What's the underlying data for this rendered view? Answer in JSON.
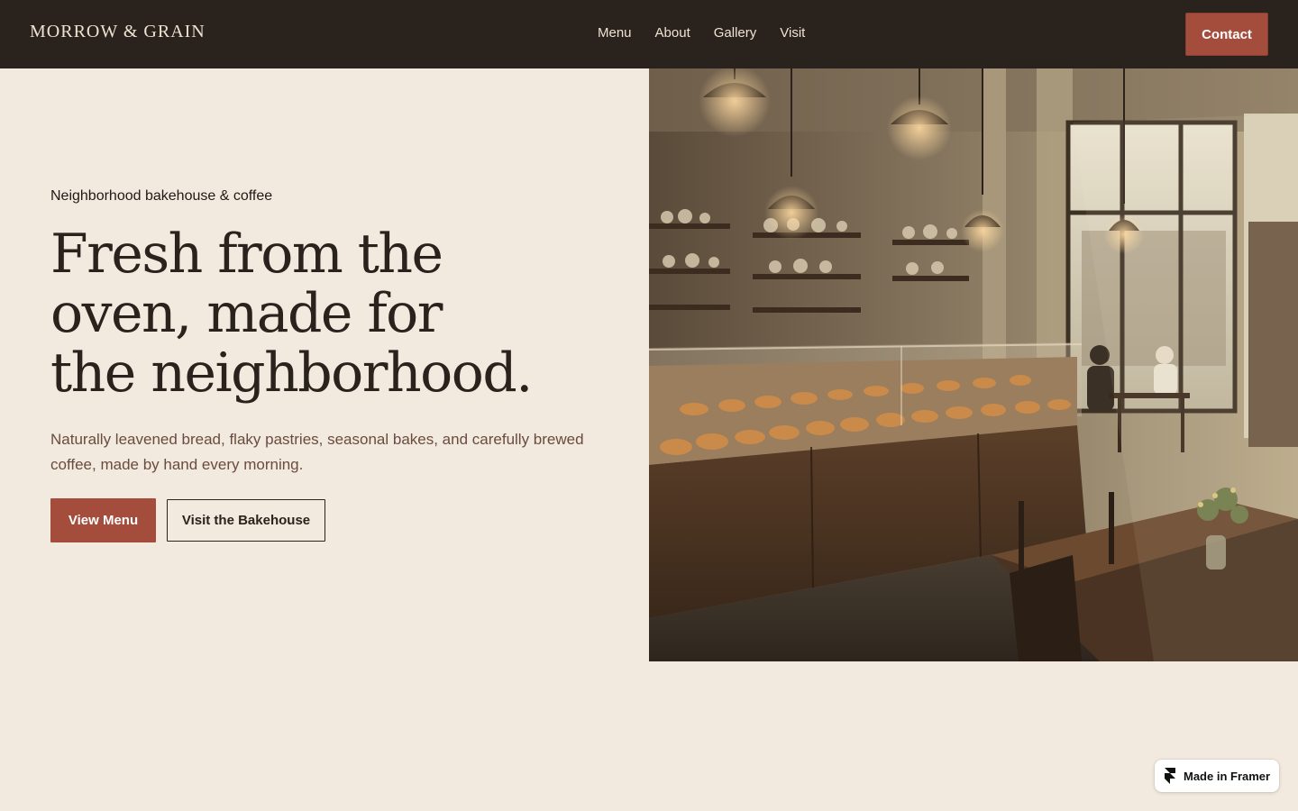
{
  "header": {
    "brand": "MORROW & GRAIN",
    "nav": [
      {
        "label": "Menu"
      },
      {
        "label": "About"
      },
      {
        "label": "Gallery"
      },
      {
        "label": "Visit"
      }
    ],
    "contact_label": "Contact"
  },
  "hero": {
    "eyebrow": "Neighborhood bakehouse & coffee",
    "headline_lines": [
      "Fresh from the",
      "oven, made for",
      "the neighborhood."
    ],
    "subcopy": "Naturally leavened bread, flaky pastries, seasonal bakes, and carefully brewed coffee, made by hand every morning.",
    "primary_cta": "View Menu",
    "secondary_cta": "Visit the Bakehouse",
    "image_subject": "bakery interior with pastry display case, pendant lamps, shelves and window seating"
  },
  "badge": {
    "label": "Made in Framer",
    "icon": "framer-logo-icon"
  },
  "colors": {
    "page_bg": "#f2eade",
    "header_bg": "#2a221d",
    "accent": "#a44d3c",
    "heading_text": "#2a221d",
    "body_text": "#6a4b3f",
    "nav_text": "#efe4d2"
  }
}
